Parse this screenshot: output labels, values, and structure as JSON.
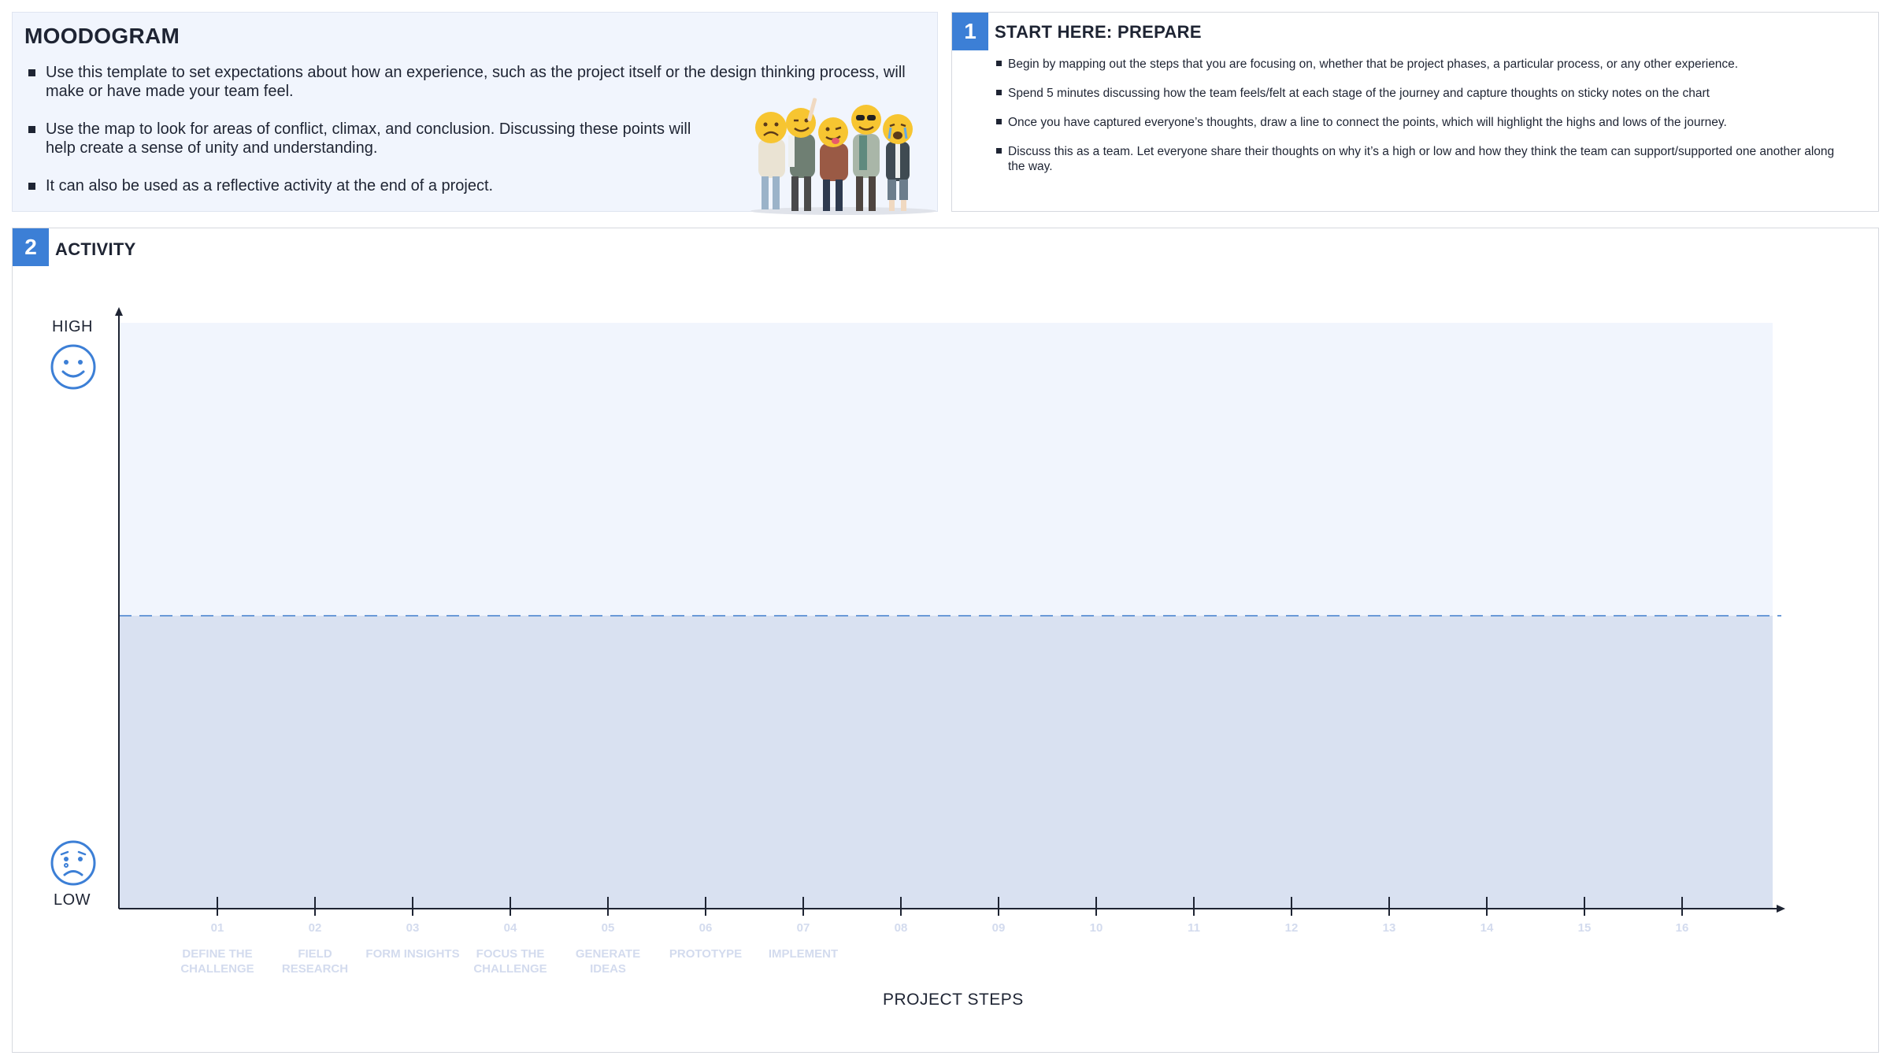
{
  "intro": {
    "title": "MOODOGRAM",
    "bullets": [
      "Use this template to set expectations about how an experience, such as the project itself or the design thinking process, will make or have made your team feel.",
      "Use the map to look for areas of conflict, climax, and conclusion. Discussing these points will help create a sense of unity and understanding.",
      "It can also be used as a reflective activity at the end of a project."
    ],
    "illustration": "group-of-people-with-emoji-faces"
  },
  "prepare": {
    "number": "1",
    "title": "START HERE: PREPARE",
    "bullets": [
      "Begin by mapping out the steps that you are focusing on, whether that be project phases, a particular process, or any other experience.",
      "Spend 5 minutes discussing how the team feels/felt at each stage of the journey and capture thoughts on sticky notes on the chart",
      "Once you have captured everyone’s thoughts, draw a line to connect the points, which will highlight the highs and lows of the journey.",
      "Discuss this as a team. Let everyone share their thoughts on why it’s a high or low and how they think the team can support/supported one another along the way."
    ]
  },
  "activity": {
    "number": "2",
    "title": "ACTIVITY",
    "high_label": "HIGH",
    "low_label": "LOW",
    "high_icon": "happy-face-icon",
    "low_icon": "sad-face-icon",
    "xlabel": "PROJECT STEPS",
    "steps": [
      {
        "num": "01",
        "name": "DEFINE THE CHALLENGE"
      },
      {
        "num": "02",
        "name": "FIELD RESEARCH"
      },
      {
        "num": "03",
        "name": "FORM INSIGHTS"
      },
      {
        "num": "04",
        "name": "FOCUS THE CHALLENGE"
      },
      {
        "num": "05",
        "name": "GENERATE IDEAS"
      },
      {
        "num": "06",
        "name": "PROTOTYPE"
      },
      {
        "num": "07",
        "name": "IMPLEMENT"
      },
      {
        "num": "08",
        "name": ""
      },
      {
        "num": "09",
        "name": ""
      },
      {
        "num": "10",
        "name": ""
      },
      {
        "num": "11",
        "name": ""
      },
      {
        "num": "12",
        "name": ""
      },
      {
        "num": "13",
        "name": ""
      },
      {
        "num": "14",
        "name": ""
      },
      {
        "num": "15",
        "name": ""
      },
      {
        "num": "16",
        "name": ""
      }
    ],
    "colors": {
      "upper_zone": "#f1f5fd",
      "lower_zone": "#d9e1f1",
      "midline": "#6a9ad8",
      "axis": "#1e2433",
      "accent": "#3c7fd6",
      "face_icon": "#3c7fd6",
      "step_text": "#d3dbee"
    }
  }
}
